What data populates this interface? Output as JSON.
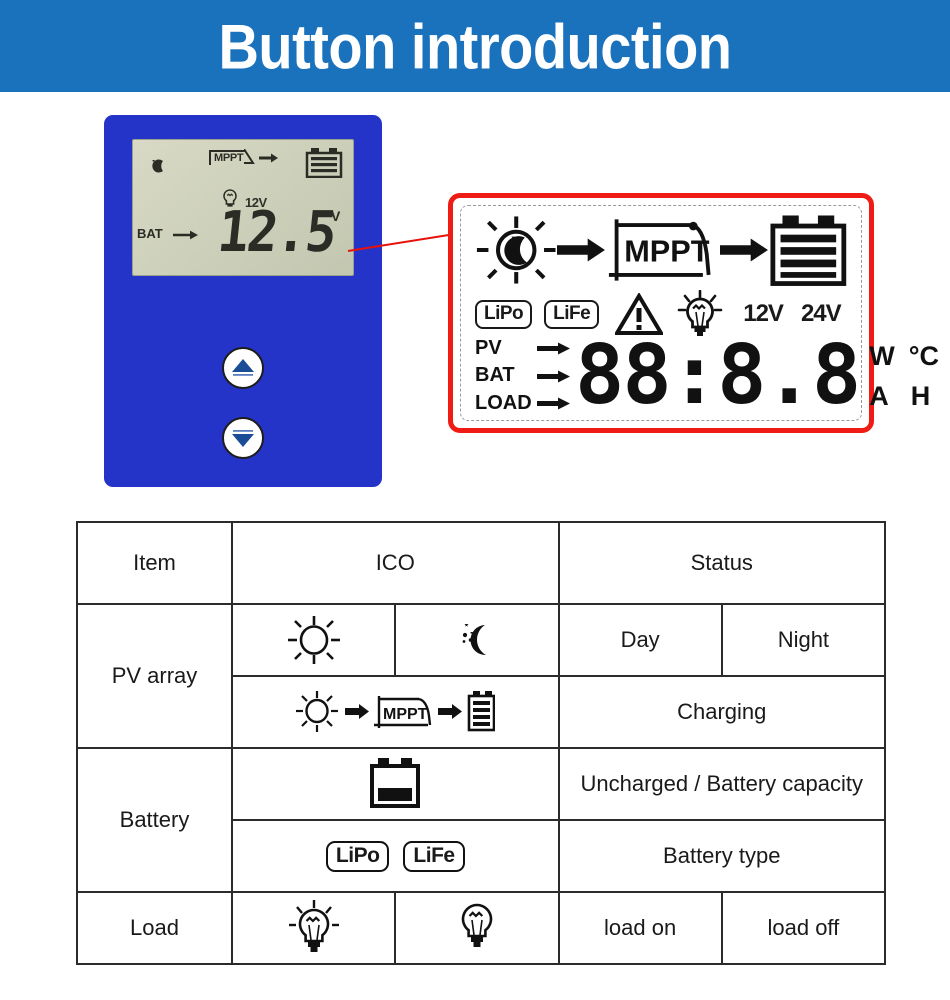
{
  "header": {
    "title": "Button introduction"
  },
  "device": {
    "name": "solar-charge-controller",
    "body_color": "#2433c8",
    "lcd": {
      "moon_icon": "moon-stars-icon",
      "mppt_label": "MPPT",
      "battery_icon": "battery-icon",
      "bulb_icon": "bulb-icon",
      "voltage_tag": "12V",
      "bat_label": "BAT",
      "value": "12.5",
      "value_unit": "V"
    },
    "buttons": [
      {
        "name": "up-button",
        "icon": "triangle-up-icon"
      },
      {
        "name": "down-button",
        "icon": "triangle-down-icon"
      }
    ]
  },
  "lcd_panel": {
    "border_color": "#ee1c14",
    "top_row": {
      "sun_icon": "sun-moon-icon",
      "arrow1": "arrow-right-icon",
      "mppt_label": "MPPT",
      "arrow2": "arrow-right-icon",
      "battery_icon": "battery-full-icon"
    },
    "mid_row": {
      "tags": [
        "LiPo",
        "LiFe"
      ],
      "warning_icon": "warning-triangle-icon",
      "bulb_icon": "bulb-on-icon",
      "volts": [
        "12V",
        "24V"
      ]
    },
    "bottom_row": {
      "labels": [
        "PV",
        "BAT",
        "LOAD"
      ],
      "digits": "88:8.8",
      "units_top": [
        "W",
        "°C"
      ],
      "units_bottom": [
        "A",
        "H"
      ]
    }
  },
  "table": {
    "headers": [
      "Item",
      "ICO",
      "Status"
    ],
    "rows": [
      {
        "item": "PV array",
        "sub": [
          {
            "icons": [
              "sun-icon",
              "moon-stars-icon"
            ],
            "status": [
              "Day",
              "Night"
            ]
          },
          {
            "icons": [
              "charging-flow-icon"
            ],
            "status": [
              "Charging"
            ]
          }
        ]
      },
      {
        "item": "Battery",
        "sub": [
          {
            "icons": [
              "battery-partial-icon"
            ],
            "status": [
              "Uncharged / Battery capacity"
            ]
          },
          {
            "icons": [
              "lipo-tag",
              "life-tag"
            ],
            "tags": [
              "LiPo",
              "LiFe"
            ],
            "status": [
              "Battery type"
            ]
          }
        ]
      },
      {
        "item": "Load",
        "sub": [
          {
            "icons": [
              "bulb-on-icon",
              "bulb-off-icon"
            ],
            "status": [
              "load on",
              "load off"
            ]
          }
        ]
      }
    ]
  }
}
